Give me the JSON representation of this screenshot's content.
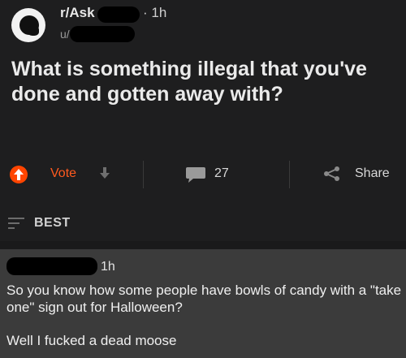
{
  "post": {
    "subreddit": "r/Ask",
    "time": "· 1h",
    "user": "u/",
    "title": "What is something illegal that you've done and gotten away with?"
  },
  "actions": {
    "vote_label": "Vote",
    "comment_count": "27",
    "share_label": "Share"
  },
  "sort": {
    "label": "BEST"
  },
  "comment": {
    "time": "1h",
    "paragraph1": "So you know how some people have bowls of candy with a \"take one\" sign out for Halloween?",
    "paragraph2": "Well I fucked a dead moose"
  },
  "colors": {
    "background": "#1a1a1b",
    "upvote_accent": "#ff4500",
    "comment_bg": "#3b3b3b"
  }
}
